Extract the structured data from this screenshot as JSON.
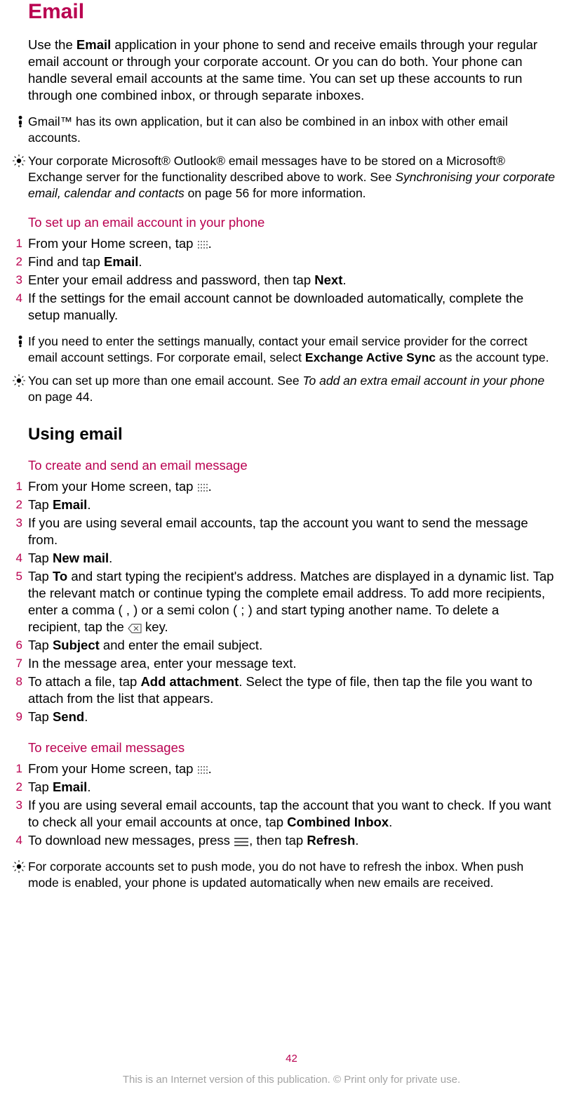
{
  "title": "Email",
  "lead": {
    "p1a": "Use the ",
    "p1b_bold": "Email",
    "p1c": " application in your phone to send and receive emails through your regular email account or through your corporate account. Or you can do both. Your phone can handle several email accounts at the same time. You can set up these accounts to run through one combined inbox, or through separate inboxes."
  },
  "notes": {
    "gmail": "Gmail™ has its own application, but it can also be combined in an inbox with other email accounts.",
    "outlook_a": "Your corporate Microsoft® Outlook® email messages have to be stored on a Microsoft® Exchange server for the functionality described above to work. See ",
    "outlook_italic": "Synchronising your corporate email, calendar and contacts",
    "outlook_b": " on page 56 for more information.",
    "manual_a": "If you need to enter the settings manually, contact your email service provider for the correct email account settings. For corporate email, select ",
    "manual_bold": "Exchange Active Sync",
    "manual_b": " as the account type.",
    "extra_a": "You can set up more than one email account. See ",
    "extra_italic": "To add an extra email account in your phone",
    "extra_b": " on page 44.",
    "push": "For corporate accounts set to push mode, you do not have to refresh the inbox. When push mode is enabled, your phone is updated automatically when new emails are received."
  },
  "setup": {
    "heading": "To set up an email account in your phone",
    "steps": {
      "n1": "1",
      "s1a": "From your Home screen, tap ",
      "s1b": ".",
      "n2": "2",
      "s2a": "Find and tap ",
      "s2b_bold": "Email",
      "s2c": ".",
      "n3": "3",
      "s3a": "Enter your email address and password, then tap ",
      "s3b_bold": "Next",
      "s3c": ".",
      "n4": "4",
      "s4": "If the settings for the email account cannot be downloaded automatically, complete the setup manually."
    }
  },
  "using": {
    "heading": "Using email"
  },
  "create": {
    "heading": "To create and send an email message",
    "steps": {
      "n1": "1",
      "s1a": "From your Home screen, tap ",
      "s1b": ".",
      "n2": "2",
      "s2a": "Tap ",
      "s2b_bold": "Email",
      "s2c": ".",
      "n3": "3",
      "s3": "If you are using several email accounts, tap the account you want to send the message from.",
      "n4": "4",
      "s4a": "Tap ",
      "s4b_bold": "New mail",
      "s4c": ".",
      "n5": "5",
      "s5a": "Tap ",
      "s5b_bold": "To",
      "s5c": " and start typing the recipient's address. Matches are displayed in a dynamic list. Tap the relevant match or continue typing the complete email address. To add more recipients, enter a comma ( , ) or a semi colon ( ; ) and start typing another name. To delete a recipient, tap the ",
      "s5d": " key.",
      "n6": "6",
      "s6a": "Tap ",
      "s6b_bold": "Subject",
      "s6c": " and enter the email subject.",
      "n7": "7",
      "s7": "In the message area, enter your message text.",
      "n8": "8",
      "s8a": "To attach a file, tap ",
      "s8b_bold": "Add attachment",
      "s8c": ". Select the type of file, then tap the file you want to attach from the list that appears.",
      "n9": "9",
      "s9a": "Tap ",
      "s9b_bold": "Send",
      "s9c": "."
    }
  },
  "receive": {
    "heading": "To receive email messages",
    "steps": {
      "n1": "1",
      "s1a": "From your Home screen, tap ",
      "s1b": ".",
      "n2": "2",
      "s2a": "Tap ",
      "s2b_bold": "Email",
      "s2c": ".",
      "n3": "3",
      "s3a": "If you are using several email accounts, tap the account that you want to check. If you want to check all your email accounts at once, tap ",
      "s3b_bold": "Combined Inbox",
      "s3c": ".",
      "n4": "4",
      "s4a": "To download new messages, press ",
      "s4b": ", then tap ",
      "s4c_bold": "Refresh",
      "s4d": "."
    }
  },
  "footer": {
    "page_number": "42",
    "disclaimer": "This is an Internet version of this publication. © Print only for private use."
  }
}
